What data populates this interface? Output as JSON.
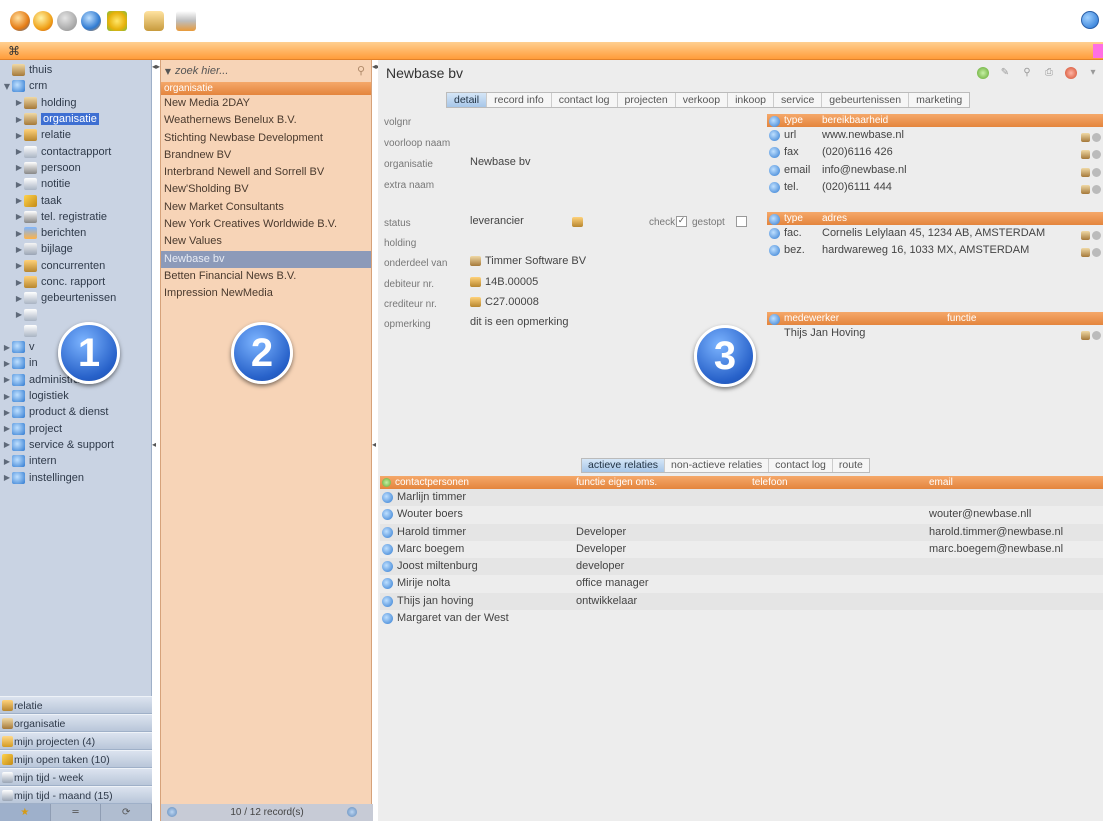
{
  "toolbar": {
    "icons": [
      "globe-orange-icon",
      "globe-yellow-icon",
      "gray-circle-icon",
      "globe-gear-icon",
      "favorites-star-icon",
      "people-icon",
      "print-icon"
    ],
    "help_icon": "help-globe-icon"
  },
  "orange_bar": {
    "icon": "bug-icon"
  },
  "nav": {
    "tree": [
      {
        "label": "thuis",
        "indent": 0,
        "arrow": "",
        "icon": "house"
      },
      {
        "label": "crm",
        "indent": 0,
        "arrow": "▼",
        "icon": "globe"
      },
      {
        "label": "holding",
        "indent": 1,
        "arrow": "▶",
        "icon": "house"
      },
      {
        "label": "organisatie",
        "indent": 1,
        "arrow": "▶",
        "icon": "house",
        "selected": true
      },
      {
        "label": "relatie",
        "indent": 1,
        "arrow": "▶",
        "icon": "people"
      },
      {
        "label": "contactrapport",
        "indent": 1,
        "arrow": "▶",
        "icon": "doc"
      },
      {
        "label": "persoon",
        "indent": 1,
        "arrow": "▶",
        "icon": "phone"
      },
      {
        "label": "notitie",
        "indent": 1,
        "arrow": "▶",
        "icon": "doc"
      },
      {
        "label": "taak",
        "indent": 1,
        "arrow": "▶",
        "icon": "pencil"
      },
      {
        "label": "tel. registratie",
        "indent": 1,
        "arrow": "▶",
        "icon": "phone"
      },
      {
        "label": "berichten",
        "indent": 1,
        "arrow": "▶",
        "icon": "mail"
      },
      {
        "label": "bijlage",
        "indent": 1,
        "arrow": "▶",
        "icon": "clip"
      },
      {
        "label": "concurrenten",
        "indent": 1,
        "arrow": "▶",
        "icon": "people"
      },
      {
        "label": "conc. rapport",
        "indent": 1,
        "arrow": "▶",
        "icon": "people"
      },
      {
        "label": "gebeurtenissen",
        "indent": 1,
        "arrow": "▶",
        "icon": "doc"
      },
      {
        "label": "",
        "indent": 1,
        "arrow": "▶",
        "icon": "doc"
      },
      {
        "label": "",
        "indent": 1,
        "arrow": "",
        "icon": "doc"
      },
      {
        "label": "v",
        "indent": 0,
        "arrow": "▶",
        "icon": "globe"
      },
      {
        "label": "in",
        "indent": 0,
        "arrow": "▶",
        "icon": "globe"
      },
      {
        "label": "administratie",
        "indent": 0,
        "arrow": "▶",
        "icon": "globe"
      },
      {
        "label": "logistiek",
        "indent": 0,
        "arrow": "▶",
        "icon": "globe"
      },
      {
        "label": "product & dienst",
        "indent": 0,
        "arrow": "▶",
        "icon": "globe"
      },
      {
        "label": "project",
        "indent": 0,
        "arrow": "▶",
        "icon": "globe"
      },
      {
        "label": "service & support",
        "indent": 0,
        "arrow": "▶",
        "icon": "globe"
      },
      {
        "label": "intern",
        "indent": 0,
        "arrow": "▶",
        "icon": "globe"
      },
      {
        "label": "instellingen",
        "indent": 0,
        "arrow": "▶",
        "icon": "globe"
      }
    ],
    "shortcuts": [
      {
        "label": "relatie",
        "icon": "people"
      },
      {
        "label": "organisatie",
        "icon": "house"
      },
      {
        "label": "mijn projecten (4)",
        "icon": "folder"
      },
      {
        "label": "mijn open taken (10)",
        "icon": "pencil"
      },
      {
        "label": "mijn tijd - week",
        "icon": "clock"
      },
      {
        "label": "mijn tijd - maand (15)",
        "icon": "clock"
      }
    ],
    "bottom_tabs": [
      "★",
      "═",
      "⟳"
    ]
  },
  "badges": [
    "1",
    "2",
    "3"
  ],
  "list": {
    "search_placeholder": "zoek hier...",
    "header": "organisatie",
    "items": [
      "New Media 2DAY",
      "Weathernews Benelux B.V.",
      "Stichting Newbase Development",
      "Brandnew BV",
      "Interbrand Newell and Sorrell BV",
      "New'Sholding BV",
      "New Market Consultants",
      "New York Creatives Worldwide B.V.",
      "New Values",
      "Newbase bv",
      "Betten Financial News B.V.",
      "Impression NewMedia"
    ],
    "selected_index": 9,
    "footer": "10 / 12 record(s)"
  },
  "detail": {
    "title": "Newbase bv",
    "tabs": [
      "detail",
      "record info",
      "contact log",
      "projecten",
      "verkoop",
      "inkoop",
      "service",
      "gebeurtenissen",
      "marketing"
    ],
    "active_tab": "detail",
    "fields": {
      "volgnr_label": "volgnr",
      "voorloop_label": "voorloop naam",
      "organisatie_label": "organisatie",
      "organisatie_value": "Newbase bv",
      "extra_label": "extra naam",
      "status_label": "status",
      "status_value": "leverancier",
      "check_label": "check",
      "gestopt_label": "gestopt",
      "holding_label": "holding",
      "onderdeel_label": "onderdeel van",
      "onderdeel_value": "Timmer Software BV",
      "debiteur_label": "debiteur nr.",
      "debiteur_value": "14B.00005",
      "crediteur_label": "crediteur nr.",
      "crediteur_value": "C27.00008",
      "opmerking_label": "opmerking",
      "opmerking_value": "dit is een opmerking"
    },
    "reach_table": {
      "headers": [
        "type",
        "bereikbaarheid"
      ],
      "rows": [
        {
          "type": "url",
          "value": "www.newbase.nl"
        },
        {
          "type": "fax",
          "value": "(020)6116 426"
        },
        {
          "type": "email",
          "value": "info@newbase.nl"
        },
        {
          "type": "tel.",
          "value": "(020)6111 444"
        }
      ]
    },
    "address_table": {
      "headers": [
        "type",
        "adres"
      ],
      "rows": [
        {
          "type": "fac.",
          "value": "Cornelis Lelylaan 45, 1234 AB, AMSTERDAM"
        },
        {
          "type": "bez.",
          "value": "hardwareweg 16, 1033 MX, AMSTERDAM"
        }
      ]
    },
    "staff_table": {
      "headers": [
        "medewerker",
        "functie"
      ],
      "rows": [
        {
          "name": "Thijs Jan Hoving",
          "function": ""
        }
      ]
    },
    "subtabs": [
      "actieve relaties",
      "non-actieve relaties",
      "contact log",
      "route"
    ],
    "active_subtab": "actieve relaties",
    "contacts": {
      "headers": [
        "contactpersonen",
        "functie eigen oms.",
        "telefoon",
        "email"
      ],
      "rows": [
        {
          "name": "Marlijn timmer",
          "function": "",
          "phone": "",
          "email": ""
        },
        {
          "name": "Wouter boers",
          "function": "",
          "phone": "",
          "email": "wouter@newbase.nll"
        },
        {
          "name": "Harold timmer",
          "function": "Developer",
          "phone": "",
          "email": "harold.timmer@newbase.nl"
        },
        {
          "name": "Marc boegem",
          "function": "Developer",
          "phone": "",
          "email": "marc.boegem@newbase.nl"
        },
        {
          "name": "Joost miltenburg",
          "function": "developer",
          "phone": "",
          "email": ""
        },
        {
          "name": "Mirije nolta",
          "function": "office manager",
          "phone": "",
          "email": ""
        },
        {
          "name": "Thijs jan hoving",
          "function": "ontwikkelaar",
          "phone": "",
          "email": ""
        },
        {
          "name": "Margaret van der West",
          "function": "",
          "phone": "",
          "email": ""
        }
      ]
    }
  }
}
